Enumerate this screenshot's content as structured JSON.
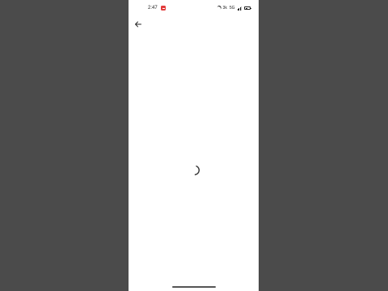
{
  "status_bar": {
    "time": "2:47",
    "network_speed": "3k",
    "network_type": "5G",
    "signal_level": 0.75,
    "battery_level": 0.45
  },
  "icons": {
    "back": "arrow-left-icon",
    "loading": "loading-spinner-icon",
    "do_not_disturb": "moon-icon",
    "notification": "notification-badge-icon",
    "battery": "battery-icon",
    "signal": "signal-bars-icon"
  },
  "colors": {
    "background_outer": "#4b4b4b",
    "screen": "#ffffff",
    "notification_badge": "#e23b3b",
    "icon": "#222222"
  }
}
